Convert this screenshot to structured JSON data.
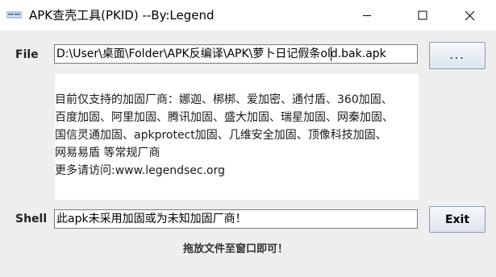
{
  "window": {
    "title": "APK查壳工具(PKID) --By:Legend",
    "icon": "app-icon",
    "controls": {
      "minimize": "minimize-icon",
      "maximize": "maximize-icon",
      "close": "close-icon"
    }
  },
  "file": {
    "label": "File",
    "value": "D:\\User\\桌面\\Folder\\APK反编译\\APK\\萝卜日记假条old.bak.apk",
    "browse_label": "..."
  },
  "info": {
    "lines": [
      "目前仅支持的加固厂商：娜迦、梆梆、爱加密、通付盾、360加固、",
      "百度加固、阿里加固、腾讯加固、盛大加固、瑞星加固、网秦加固、",
      "国信灵通加固、apkprotect加固、几维安全加固、顶像科技加固、",
      "网易易盾 等常规厂商",
      "更多请访问:www.legendsec.org"
    ]
  },
  "shell": {
    "label": "Shell",
    "value": "此apk未采用加固或为未知加固厂商！",
    "exit_label": "Exit"
  },
  "hint": "拖放文件至窗口即可！",
  "colors": {
    "window_bg": "#eeeeee",
    "field_bg": "#ffffff",
    "button_border": "#8a9bb0"
  }
}
